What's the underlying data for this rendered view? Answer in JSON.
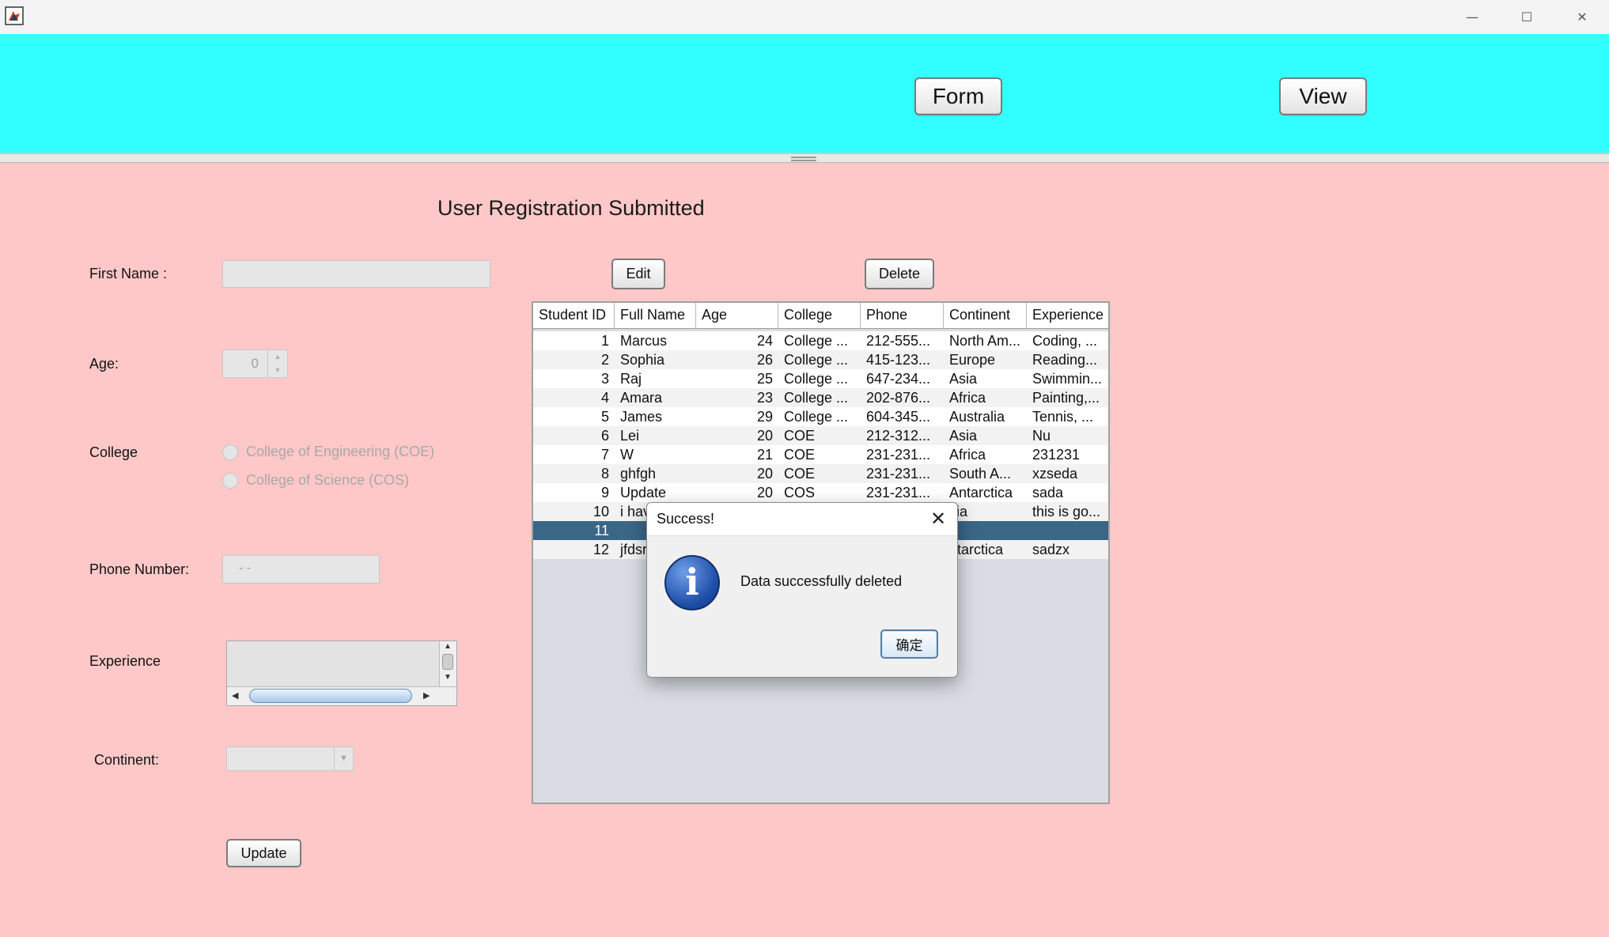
{
  "window": {
    "app_icon": "java-icon",
    "controls": {
      "minimize": "—",
      "maximize": "☐",
      "close": "✕"
    }
  },
  "nav": {
    "form_label": "Form",
    "view_label": "View"
  },
  "heading": "User Registration Submitted",
  "form": {
    "first_name_label": "First Name :",
    "first_name_value": "",
    "age_label": "Age:",
    "age_value": "0",
    "college_label": "College",
    "college_options": [
      "College of Engineering (COE)",
      "College of Science (COS)"
    ],
    "phone_label": "Phone Number:",
    "phone_value": " -  -",
    "experience_label": "Experience",
    "continent_label": "Continent:",
    "continent_value": "",
    "update_label": "Update"
  },
  "actions": {
    "edit_label": "Edit",
    "delete_label": "Delete"
  },
  "table": {
    "columns": [
      "Student ID",
      "Full Name",
      "Age",
      "College",
      "Phone",
      "Continent",
      "Experience"
    ],
    "rows": [
      [
        "1",
        "Marcus",
        "24",
        "College ...",
        "212-555...",
        "North Am...",
        "Coding, ..."
      ],
      [
        "2",
        "Sophia",
        "26",
        "College ...",
        "415-123...",
        "Europe",
        "Reading..."
      ],
      [
        "3",
        "Raj",
        "25",
        "College ...",
        "647-234...",
        "Asia",
        "Swimmin..."
      ],
      [
        "4",
        "Amara",
        "23",
        "College ...",
        "202-876...",
        "Africa",
        "Painting,..."
      ],
      [
        "5",
        "James",
        "29",
        "College ...",
        "604-345...",
        "Australia",
        "Tennis, ..."
      ],
      [
        "6",
        "Lei",
        "20",
        " COE",
        "212-312...",
        "Asia",
        "Nu"
      ],
      [
        "7",
        "W",
        "21",
        " COE",
        "231-231...",
        "Africa",
        "231231"
      ],
      [
        "8",
        "ghfgh",
        "20",
        " COE",
        "231-231...",
        "South A...",
        "xzseda"
      ],
      [
        "9",
        "Update",
        "20",
        " COS",
        "231-231...",
        "Antarctica",
        "sada"
      ],
      [
        "10",
        "i hav",
        "",
        "",
        "",
        "sia",
        "this is go..."
      ],
      [
        "11",
        "",
        "",
        "",
        "",
        "",
        ""
      ],
      [
        "12",
        "jfdsr",
        "",
        "",
        "",
        "ntarctica",
        "sadzx"
      ]
    ],
    "selected_row": 10
  },
  "dialog": {
    "title": "Success!",
    "icon": "info-icon",
    "message": "Data successfully deleted",
    "ok_label": "确定"
  },
  "colors": {
    "top_panel": "#31ffff",
    "background": "#ffc8c8",
    "selection": "#3a6688"
  }
}
